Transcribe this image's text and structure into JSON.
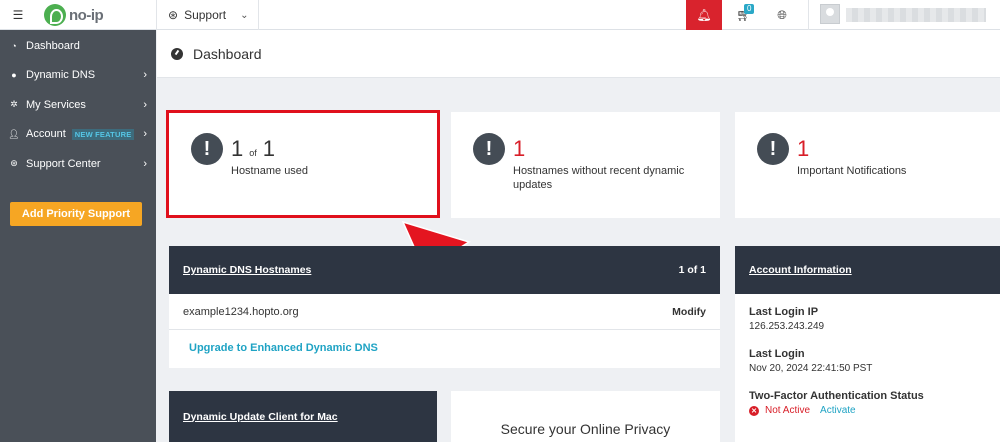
{
  "topbar": {
    "collapse_icon": "collapse-menu-icon",
    "logo_text": "no-ip",
    "support_label": "Support",
    "cart_count": "0"
  },
  "sidebar": {
    "items": [
      {
        "label": "Dashboard",
        "icon": "dashboard-icon",
        "has_arrow": false
      },
      {
        "label": "Dynamic DNS",
        "icon": "globe-icon",
        "has_arrow": true
      },
      {
        "label": "My Services",
        "icon": "gear-icon",
        "has_arrow": true
      },
      {
        "label": "Account",
        "icon": "user-icon",
        "has_arrow": true,
        "badge": "NEW FEATURE"
      },
      {
        "label": "Support Center",
        "icon": "lifebuoy-icon",
        "has_arrow": true
      }
    ],
    "priority_button": "Add Priority Support"
  },
  "page": {
    "title": "Dashboard"
  },
  "stats": [
    {
      "value": "1",
      "of_word": "of",
      "total": "1",
      "label": "Hostname used"
    },
    {
      "value": "1",
      "label": "Hostnames without recent dynamic updates"
    },
    {
      "value": "1",
      "label": "Important Notifications"
    }
  ],
  "dns_panel": {
    "title": "Dynamic DNS Hostnames",
    "pager": "1 of 1",
    "hostname": "example1234.hopto.org",
    "modify_label": "Modify",
    "upgrade_link": "Upgrade to Enhanced Dynamic DNS"
  },
  "account_panel": {
    "title": "Account Information",
    "last_login_ip_label": "Last Login IP",
    "last_login_ip": "126.253.243.249",
    "last_login_label": "Last Login",
    "last_login": "Nov 20, 2024 22:41:50 PST",
    "twofa_label": "Two-Factor Authentication Status",
    "twofa_status": "Not Active",
    "activate_label": "Activate"
  },
  "mac_panel": {
    "title": "Dynamic Update Client for Mac"
  },
  "privacy_panel": {
    "title": "Secure your Online Privacy"
  },
  "colors": {
    "accent_red": "#d81e28",
    "link_blue": "#1fa3c4",
    "sidebar_bg": "#4a5058",
    "panel_head_bg": "#2d3542",
    "priority_orange": "#f6a623"
  }
}
